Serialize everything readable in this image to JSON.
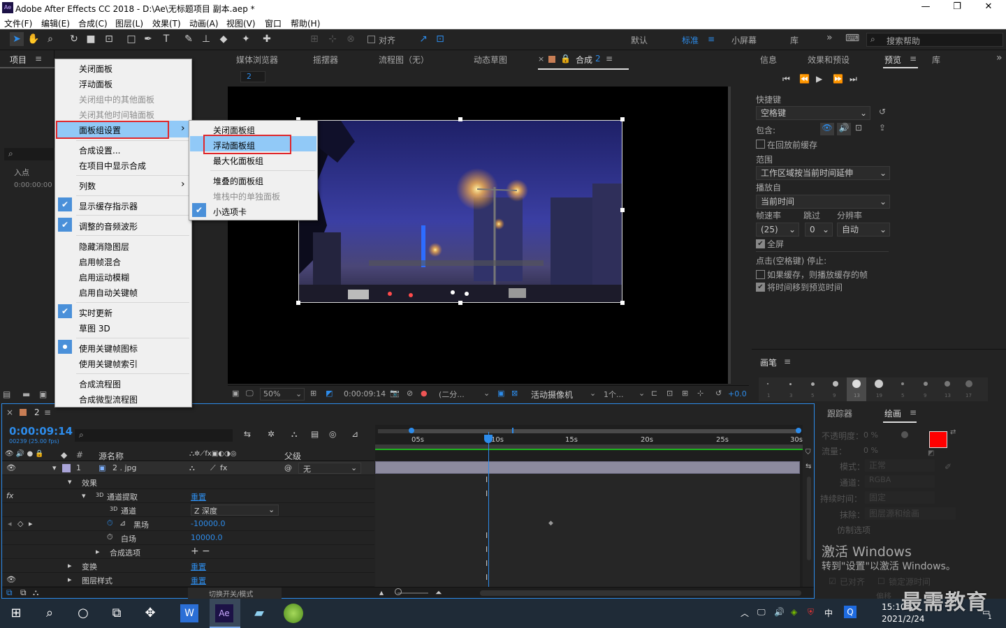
{
  "window": {
    "title": "Adobe After Effects CC 2018 - D:\\Ae\\无标题项目 副本.aep *",
    "logo": "Ae"
  },
  "menubar": [
    "文件(F)",
    "编辑(E)",
    "合成(C)",
    "图层(L)",
    "效果(T)",
    "动画(A)",
    "视图(V)",
    "窗口",
    "帮助(H)"
  ],
  "toolbar": {
    "align_label": "对齐",
    "workspaces": [
      "默认",
      "标准",
      "小屏幕",
      "库"
    ],
    "active_workspace": "标准",
    "search_placeholder": "搜索帮助"
  },
  "project_panel": {
    "tab": "项目",
    "col_in": "入点",
    "timecode": "0:00:00:00"
  },
  "context_menu": {
    "items": [
      "关闭面板",
      "浮动面板",
      "关闭组中的其他面板",
      "关闭其他时间轴面板",
      "面板组设置",
      "合成设置...",
      "在项目中显示合成",
      "列数",
      "显示缓存指示器",
      "调整的音频波形",
      "隐藏消隐图层",
      "启用帧混合",
      "启用运动模糊",
      "启用自动关键帧",
      "实时更新",
      "草图 3D",
      "使用关键帧图标",
      "使用关键帧索引",
      "合成流程图",
      "合成微型流程图"
    ],
    "submenu": [
      "关闭面板组",
      "浮动面板组",
      "最大化面板组",
      "堆叠的面板组",
      "堆栈中的单独面板",
      "小选项卡"
    ],
    "arrow": "›",
    "check": "✔",
    "bullet": "●"
  },
  "viewer": {
    "tabs": [
      "媒体浏览器",
      "摇摆器",
      "流程图（无）",
      "动态草图"
    ],
    "comp_tab": "合成",
    "comp_num": "2",
    "sub_tab": "2",
    "zoom": "50%",
    "timecode": "0:00:09:14",
    "resolution": "(二分...",
    "camera": "活动摄像机",
    "views": "1个...",
    "exposure": "+0.0"
  },
  "right_panel": {
    "tabs": [
      "信息",
      "效果和预设",
      "预览",
      "库"
    ],
    "shortcut_label": "快捷键",
    "shortcut_value": "空格键",
    "include_label": "包含:",
    "cache_before": "在回放前缓存",
    "range_label": "范围",
    "range_value": "工作区域按当前时间延伸",
    "play_from_label": "播放自",
    "play_from_value": "当前时间",
    "fps_label": "帧速率",
    "skip_label": "跳过",
    "res_label": "分辨率",
    "fps_value": "(25)",
    "skip_value": "0",
    "res_value": "自动",
    "fullscreen": "全屏",
    "stop_label": "点击(空格键) 停止:",
    "opt1": "如果缓存，则播放缓存的帧",
    "opt2": "将时间移到预览时间",
    "brush_tab": "画笔",
    "brush_sizes": [
      "1",
      "3",
      "5",
      "9",
      "13",
      "19",
      "5",
      "9",
      "13",
      "17"
    ]
  },
  "paint_panel": {
    "tabs": [
      "跟踪器",
      "绘画"
    ],
    "opacity_label": "不透明度：",
    "opacity_value": "0 %",
    "flow_label": "流量：",
    "flow_value": "0 %",
    "mode_label": "模式：",
    "mode_value": "正常",
    "channel_label": "通道：",
    "channel_value": "RGBA",
    "duration_label": "持续时间：",
    "duration_value": "固定",
    "erase_label": "抹除：",
    "erase_value": "图层源和绘画",
    "clone_label": "仿制选项",
    "aligned": "已对齐",
    "lock_time": "锁定源时间",
    "offset": "偏移",
    "watermark1": "激活 Windows",
    "watermark2": "转到\"设置\"以激活 Windows。"
  },
  "timeline": {
    "tab": "2",
    "timecode": "0:00:09:14",
    "frames": "00239 (25.00 fps)",
    "col_num": "#",
    "col_source": "源名称",
    "col_parent": "父级",
    "ruler": [
      "05s",
      "10s",
      "15s",
      "20s",
      "25s",
      "30s"
    ],
    "layer_num": "1",
    "layer_name": "2 . jpg",
    "parent_value": "无",
    "effects": "效果",
    "fx_name": "通道提取",
    "reset": "重置",
    "channel_label": "通道",
    "channel_value": "Z 深度",
    "black_label": "黑场",
    "black_value": "-10000.0",
    "white_label": "白场",
    "white_value": "10000.0",
    "comp_options": "合成选项",
    "transform": "变换",
    "layer_styles": "图层样式",
    "toggle_modes": "切换开关/模式",
    "threed": "3D",
    "fx": "fx"
  },
  "taskbar": {
    "time": "15:10",
    "date": "2021/2/24",
    "ime": "中",
    "notify": "1"
  },
  "watermark_logo": "最需教育"
}
